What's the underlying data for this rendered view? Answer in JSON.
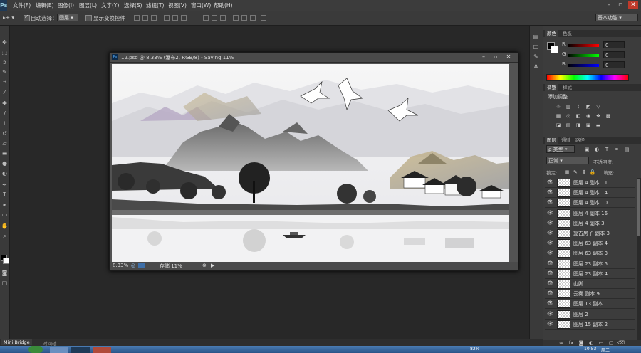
{
  "menubar": {
    "logo": "Ps",
    "items": [
      "文件(F)",
      "编辑(E)",
      "图像(I)",
      "图层(L)",
      "文字(Y)",
      "选择(S)",
      "滤镜(T)",
      "视图(V)",
      "窗口(W)",
      "帮助(H)"
    ]
  },
  "optionsbar": {
    "auto_select_label": "自动选择：",
    "auto_select_value": "图层",
    "show_transform_label": "显示变换控件",
    "workspace": "基本功能"
  },
  "document": {
    "title": "12.psd @ 8.33% (瀑布2, RGB/8) - Saving 11%",
    "zoom": "8.33%",
    "status": "存储 11%"
  },
  "color_panel": {
    "tabs": [
      "颜色",
      "色板"
    ],
    "channels": [
      {
        "label": "R",
        "value": "0"
      },
      {
        "label": "G",
        "value": "0"
      },
      {
        "label": "B",
        "value": "0"
      }
    ]
  },
  "adjust_panel": {
    "tabs": [
      "调整",
      "样式"
    ],
    "title": "添加调整"
  },
  "layers_panel": {
    "tabs": [
      "图层",
      "通道",
      "路径"
    ],
    "kind_filter": "类型",
    "blend_mode": "正常",
    "opacity_label": "不透明度:",
    "lock_label": "锁定:",
    "fill_label": "填充:",
    "layers": [
      "图层 4 副本 11",
      "图层 4 副本 14",
      "图层 4 副本 10",
      "图层 4 副本 16",
      "图层 4 副本 3",
      "复古房子 副本 3",
      "图层 63 副本 4",
      "图层 63 副本 3",
      "图层 23 副本 5",
      "图层 23 副本 4",
      "山脚",
      "云雾 副本 9",
      "图层 13 副本",
      "图层 2",
      "图层 15 副本 2"
    ]
  },
  "bottombar": {
    "tabs": [
      "Mini Bridge",
      "时间轴"
    ]
  },
  "taskbar": {
    "battery": "82%",
    "clock": "10:53",
    "day": "周二"
  }
}
